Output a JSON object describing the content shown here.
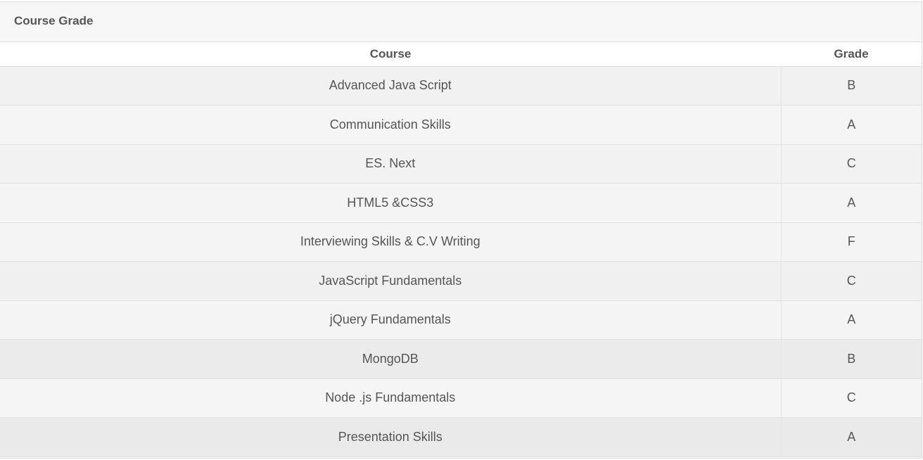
{
  "panel": {
    "title": "Course Grade"
  },
  "table": {
    "headers": {
      "course": "Course",
      "grade": "Grade"
    },
    "rows": [
      {
        "course": "Advanced Java Script",
        "grade": "B"
      },
      {
        "course": "Communication Skills",
        "grade": "A"
      },
      {
        "course": "ES. Next",
        "grade": "C"
      },
      {
        "course": "HTML5 &CSS3",
        "grade": "A"
      },
      {
        "course": "Interviewing Skills & C.V Writing",
        "grade": "F"
      },
      {
        "course": "JavaScript Fundamentals",
        "grade": "C"
      },
      {
        "course": "jQuery Fundamentals",
        "grade": "A"
      },
      {
        "course": "MongoDB",
        "grade": "B"
      },
      {
        "course": "Node .js Fundamentals",
        "grade": "C"
      },
      {
        "course": "Presentation Skills",
        "grade": "A"
      }
    ]
  },
  "colors": {
    "text": "#555555",
    "header_bg": "#f7f7f7",
    "border": "#dcdcdc"
  }
}
